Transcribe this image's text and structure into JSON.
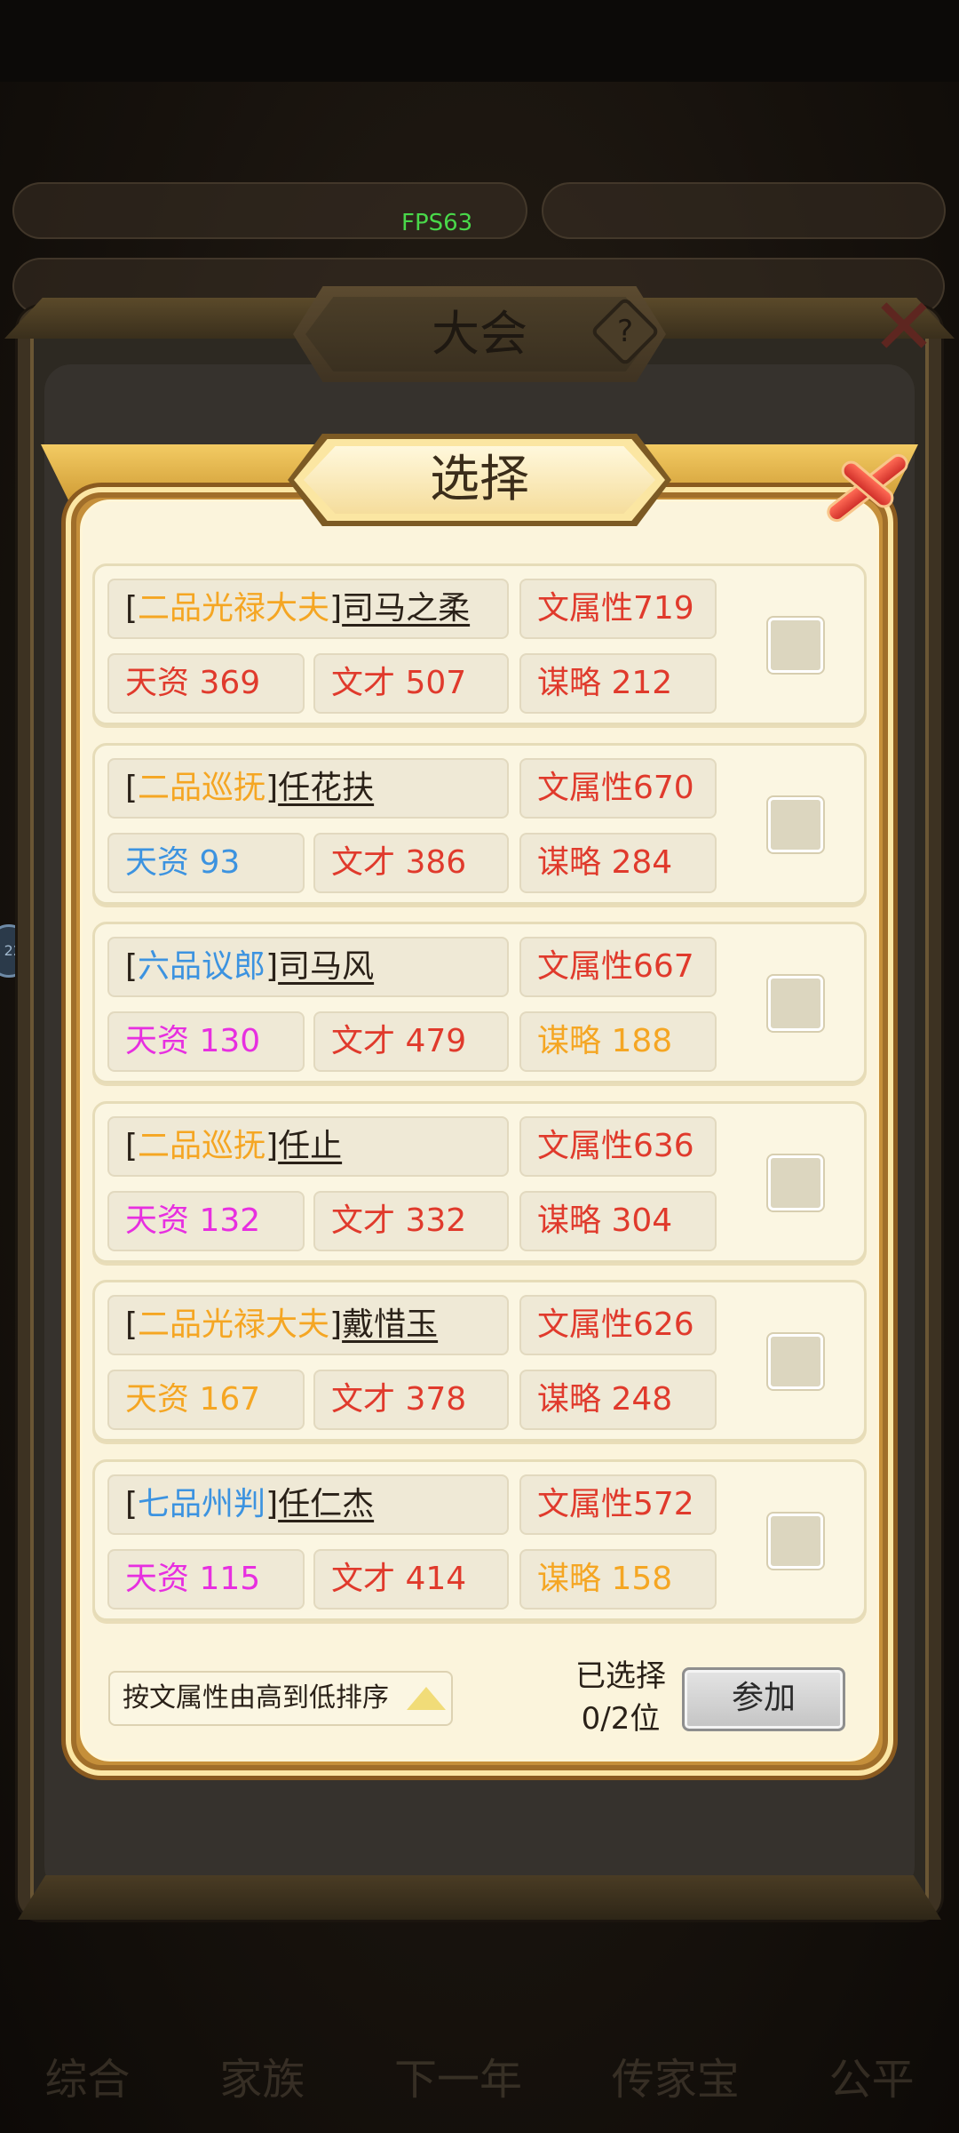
{
  "background": {
    "fps": "FPS63",
    "nav_items": [
      "综合",
      "家族",
      "下一年",
      "传家宝",
      "公平"
    ]
  },
  "outer_panel": {
    "title": "大会",
    "help_icon": "question-icon",
    "close_icon": "close-icon"
  },
  "dialog": {
    "title": "选择",
    "rows": [
      {
        "rank": "二品光禄大夫",
        "rank_color": "#f5a623",
        "name": "司马之柔",
        "attr_label": "文属性719",
        "tz": "天资 369",
        "tz_color": "#e03a2c",
        "wc": "文才 507",
        "ml": "谋略 212",
        "ml_color": "#e03a2c"
      },
      {
        "rank": "二品巡抚",
        "rank_color": "#f5a623",
        "name": "任花扶",
        "attr_label": "文属性670",
        "tz": "天资 93",
        "tz_color": "#3c93e0",
        "wc": "文才 386",
        "ml": "谋略 284",
        "ml_color": "#e03a2c"
      },
      {
        "rank": "六品议郎",
        "rank_color": "#3c93e0",
        "name": "司马风",
        "attr_label": "文属性667",
        "tz": "天资 130",
        "tz_color": "#e72fe0",
        "wc": "文才 479",
        "ml": "谋略 188",
        "ml_color": "#f5a623"
      },
      {
        "rank": "二品巡抚",
        "rank_color": "#f5a623",
        "name": "任止",
        "attr_label": "文属性636",
        "tz": "天资 132",
        "tz_color": "#e72fe0",
        "wc": "文才 332",
        "ml": "谋略 304",
        "ml_color": "#e03a2c"
      },
      {
        "rank": "二品光禄大夫",
        "rank_color": "#f5a623",
        "name": "戴惜玉",
        "attr_label": "文属性626",
        "tz": "天资 167",
        "tz_color": "#f5a623",
        "wc": "文才 378",
        "ml": "谋略 248",
        "ml_color": "#e03a2c"
      },
      {
        "rank": "七品州判",
        "rank_color": "#3c93e0",
        "name": "任仁杰",
        "attr_label": "文属性572",
        "tz": "天资 115",
        "tz_color": "#e72fe0",
        "wc": "文才 414",
        "ml": "谋略 158",
        "ml_color": "#f5a623"
      }
    ],
    "sort_label": "按文属性由高到低排序",
    "selected_label": "已选择",
    "selected_count": "0/2位",
    "join_label": "参加"
  }
}
